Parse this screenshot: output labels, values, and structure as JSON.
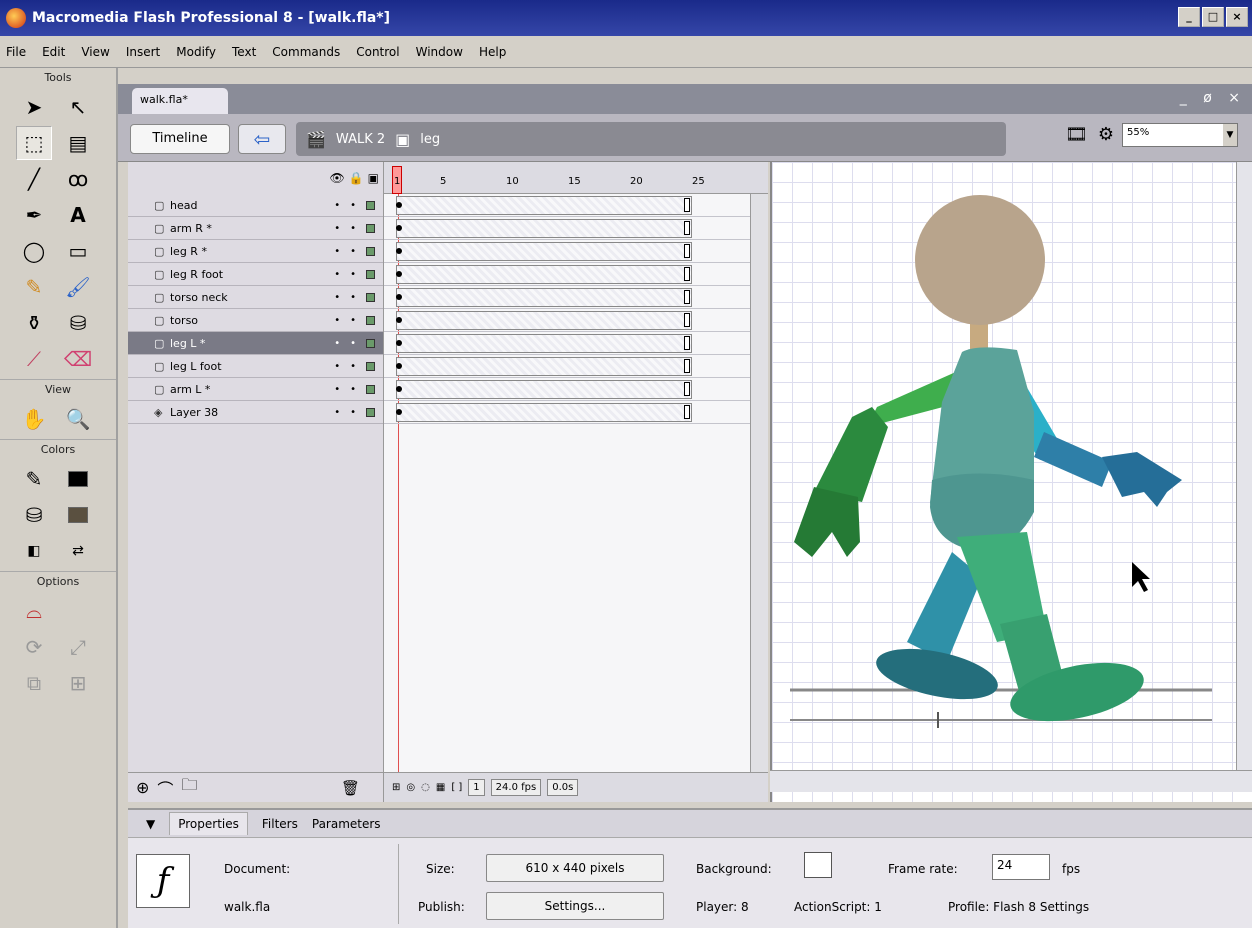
{
  "window": {
    "title": "Macromedia Flash Professional 8 - [walk.fla*]",
    "controls": [
      "_",
      "□",
      "×"
    ]
  },
  "menu": [
    "File",
    "Edit",
    "View",
    "Insert",
    "Modify",
    "Text",
    "Commands",
    "Control",
    "Window",
    "Help"
  ],
  "tools": {
    "title": "Tools",
    "view_title": "View",
    "colors_title": "Colors",
    "options_title": "Options"
  },
  "document": {
    "tab": "walk.fla*",
    "controls": "_ ø ×"
  },
  "editbar": {
    "timeline_label": "Timeline",
    "crumbs": [
      "WALK 2",
      "leg"
    ],
    "zoom": "55%"
  },
  "layers": [
    {
      "name": "head",
      "selected": false
    },
    {
      "name": "arm R *",
      "selected": false
    },
    {
      "name": "leg R *",
      "selected": false
    },
    {
      "name": "leg R foot",
      "selected": false
    },
    {
      "name": "torso neck",
      "selected": false
    },
    {
      "name": "torso",
      "selected": false
    },
    {
      "name": "leg L *",
      "selected": true
    },
    {
      "name": "leg L foot",
      "selected": false
    },
    {
      "name": "arm L *",
      "selected": false
    },
    {
      "name": "Layer 38",
      "selected": false
    }
  ],
  "ruler": [
    "1",
    "5",
    "10",
    "15",
    "20",
    "25"
  ],
  "frames_status": {
    "current_frame": "1",
    "fps": "24.0 fps",
    "time": "0.0s"
  },
  "properties": {
    "tabs": [
      "Properties",
      "Filters",
      "Parameters"
    ],
    "doc_label": "Document:",
    "doc_name": "walk.fla",
    "size_label": "Size:",
    "size_value": "610 x 440 pixels",
    "publish_label": "Publish:",
    "settings_label": "Settings...",
    "background_label": "Background:",
    "frame_rate_label": "Frame rate:",
    "frame_rate_value": "24",
    "fps_label": "fps",
    "player_label": "Player: 8",
    "actionscript_label": "ActionScript: 1",
    "profile_label": "Profile: Flash 8 Settings"
  },
  "colors": {
    "head": "#b8a48c",
    "torso": "#4e9690",
    "torso_upper": "#5ba39a",
    "arm_back": "#2b8a3e",
    "arm_back_upper": "#3fae4d",
    "arm_front": "#2e7fa8",
    "leg_back": "#2f91a8",
    "leg_front": "#3fae7a",
    "foot": "#246e7c"
  }
}
